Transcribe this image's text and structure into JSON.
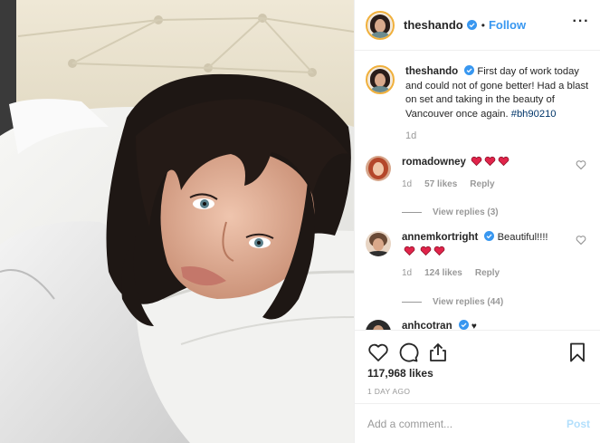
{
  "header": {
    "username": "theshando",
    "separator": "•",
    "follow_label": "Follow",
    "more_label": "···"
  },
  "caption": {
    "username": "theshando",
    "text": "First day of work today and could not of gone better! Had a blast on set and taking in the beauty of Vancouver once again. ",
    "hashtag": "#bh90210",
    "timestamp": "1d"
  },
  "comments": [
    {
      "username": "romadowney",
      "text": "",
      "hearts": 3,
      "timestamp": "1d",
      "likes": "57 likes",
      "reply_label": "Reply",
      "view_replies": "View replies (3)"
    },
    {
      "username": "annemkortright",
      "text": "Beautiful!!!! ",
      "hearts": 3,
      "timestamp": "1d",
      "likes": "124 likes",
      "reply_label": "Reply",
      "view_replies": "View replies (44)"
    },
    {
      "username": "anhcotran",
      "text": ""
    }
  ],
  "actions": {
    "likes": "117,968 likes",
    "time_ago": "1 DAY AGO"
  },
  "add_comment": {
    "placeholder": "Add a comment...",
    "post_label": "Post"
  },
  "colors": {
    "link": "#3897f0",
    "verified": "#3897f0",
    "hashtag": "#003569",
    "muted": "#999999",
    "heart_emoji": "#e0244a",
    "post_disabled": "#b2dffc"
  },
  "icons": [
    "more-options-icon",
    "verified-badge-icon",
    "heart-icon",
    "comment-icon",
    "share-icon",
    "bookmark-icon",
    "comment-heart-icon",
    "red-heart-emoji"
  ]
}
